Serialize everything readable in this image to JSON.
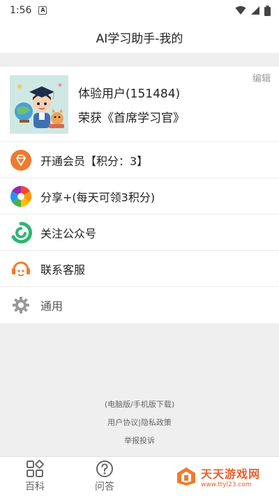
{
  "status_bar": {
    "time": "1:56",
    "badge": "A"
  },
  "title": "AI学习助手-我的",
  "profile": {
    "name": "体验用户(151484)",
    "honor": "荣获《首席学习官》",
    "edit_label": "编辑"
  },
  "menu": [
    {
      "label": "开通会员【积分：3】",
      "icon": "diamond-icon"
    },
    {
      "label": "分享+(每天可领3积分)",
      "icon": "share-aperture-icon"
    },
    {
      "label": "关注公众号",
      "icon": "official-account-icon"
    },
    {
      "label": "联系客服",
      "icon": "customer-service-icon"
    },
    {
      "label": "通用",
      "icon": "gear-icon"
    }
  ],
  "footer": {
    "versions": "(电脑版/手机版下载)",
    "agreement": "用户协议",
    "separator": "|",
    "privacy": "隐私政策",
    "report": "举报投诉"
  },
  "bottom_nav": [
    {
      "label": "百科",
      "icon": "grid-icon"
    },
    {
      "label": "问答",
      "icon": "question-icon"
    }
  ],
  "watermark": {
    "title": "天天游戏网",
    "url": "www.ttyl23.com"
  },
  "colors": {
    "accent_orange": "#f07a2e",
    "green": "#2bb673"
  }
}
